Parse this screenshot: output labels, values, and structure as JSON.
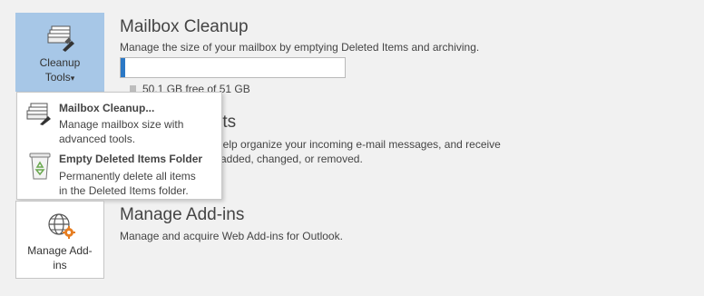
{
  "cleanup": {
    "button_line1": "Cleanup",
    "button_line2": "Tools",
    "dropdown_arrow": "▾",
    "title": "Mailbox Cleanup",
    "description": "Manage the size of your mailbox by emptying Deleted Items and archiving.",
    "storage_text": "50.1 GB free of 51 GB",
    "storage_used_fraction": 0.02
  },
  "menu": {
    "items": [
      {
        "title": "Mailbox Cleanup...",
        "desc_line1": "Manage mailbox size with",
        "desc_line2": "advanced tools."
      },
      {
        "title": "Empty Deleted Items Folder",
        "desc_line1": "Permanently delete all items",
        "desc_line2": "in the Deleted Items folder."
      }
    ]
  },
  "rules": {
    "title_fragment": "rts",
    "desc_line1": "o help organize your incoming e-mail messages, and receive",
    "desc_line2": "re added, changed, or removed."
  },
  "addins": {
    "button_line1": "Manage Add-",
    "button_line2": "ins",
    "title": "Manage Add-ins",
    "description": "Manage and acquire Web Add-ins for Outlook."
  },
  "colors": {
    "accent": "#a7c7e7",
    "progress_fill": "#2b78c5",
    "gear": "#e67e22"
  }
}
